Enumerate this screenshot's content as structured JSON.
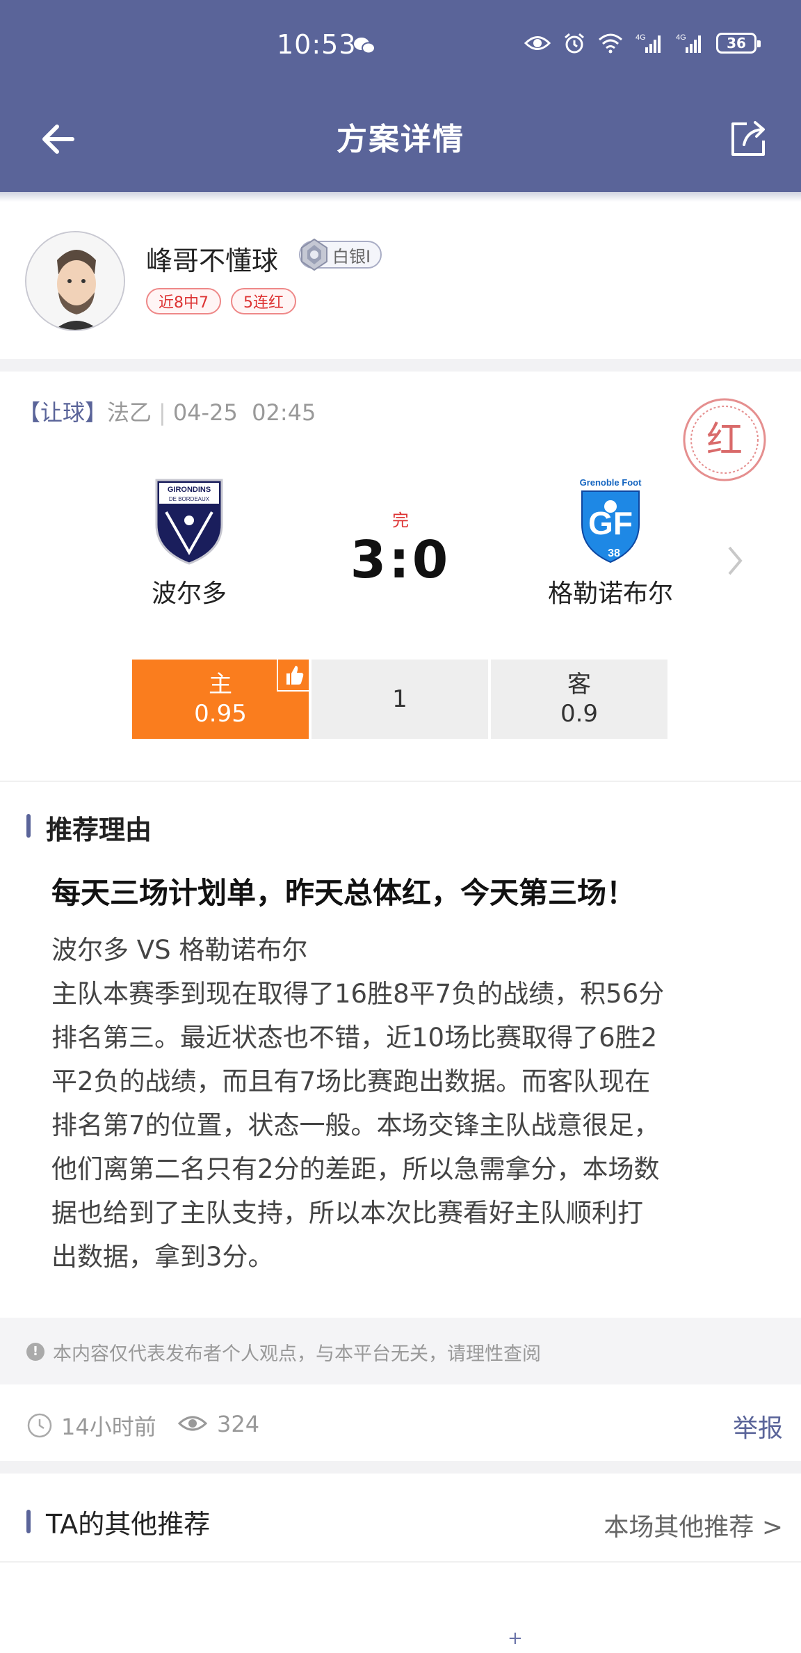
{
  "status_bar": {
    "time": "10:53",
    "battery": "36"
  },
  "nav": {
    "title": "方案详情"
  },
  "author": {
    "name": "峰哥不懂球",
    "rank": "白银I",
    "tags": [
      "近8中7",
      "5连红"
    ]
  },
  "match": {
    "type": "【让球】",
    "league": "法乙",
    "date": "04-25",
    "time": "02:45",
    "stamp": "红",
    "status": "完",
    "score": "3:0",
    "home": {
      "name": "波尔多",
      "logo_text": "GIRONDINS DE BORDEAUX"
    },
    "away": {
      "name": "格勒诺布尔",
      "logo_text": "Grenoble Foot"
    },
    "odds": [
      {
        "label": "主",
        "value": "0.95",
        "selected": true
      },
      {
        "label": "",
        "value": "1",
        "selected": false
      },
      {
        "label": "客",
        "value": "0.9",
        "selected": false
      }
    ]
  },
  "reason": {
    "section_title": "推荐理由",
    "headline": "每天三场计划单，昨天总体红，今天第三场！",
    "body": "波尔多 VS 格勒诺布尔\n主队本赛季到现在取得了16胜8平7负的战绩，积56分\n排名第三。最近状态也不错，近10场比赛取得了6胜2\n平2负的战绩，而且有7场比赛跑出数据。而客队现在\n排名第7的位置，状态一般。本场交锋主队战意很足，\n他们离第二名只有2分的差距，所以急需拿分，本场数\n据也给到了主队支持，所以本次比赛看好主队顺利打\n出数据，拿到3分。"
  },
  "disclaimer": "本内容仅代表发布者个人观点，与本平台无关，请理性查阅",
  "meta": {
    "time_ago": "14小时前",
    "views": "324",
    "report": "举报"
  },
  "other": {
    "title": "TA的其他推荐",
    "more": "本场其他推荐 >"
  },
  "colors": {
    "primary": "#5a6499",
    "orange": "#fa7d1e",
    "red": "#d33333"
  }
}
